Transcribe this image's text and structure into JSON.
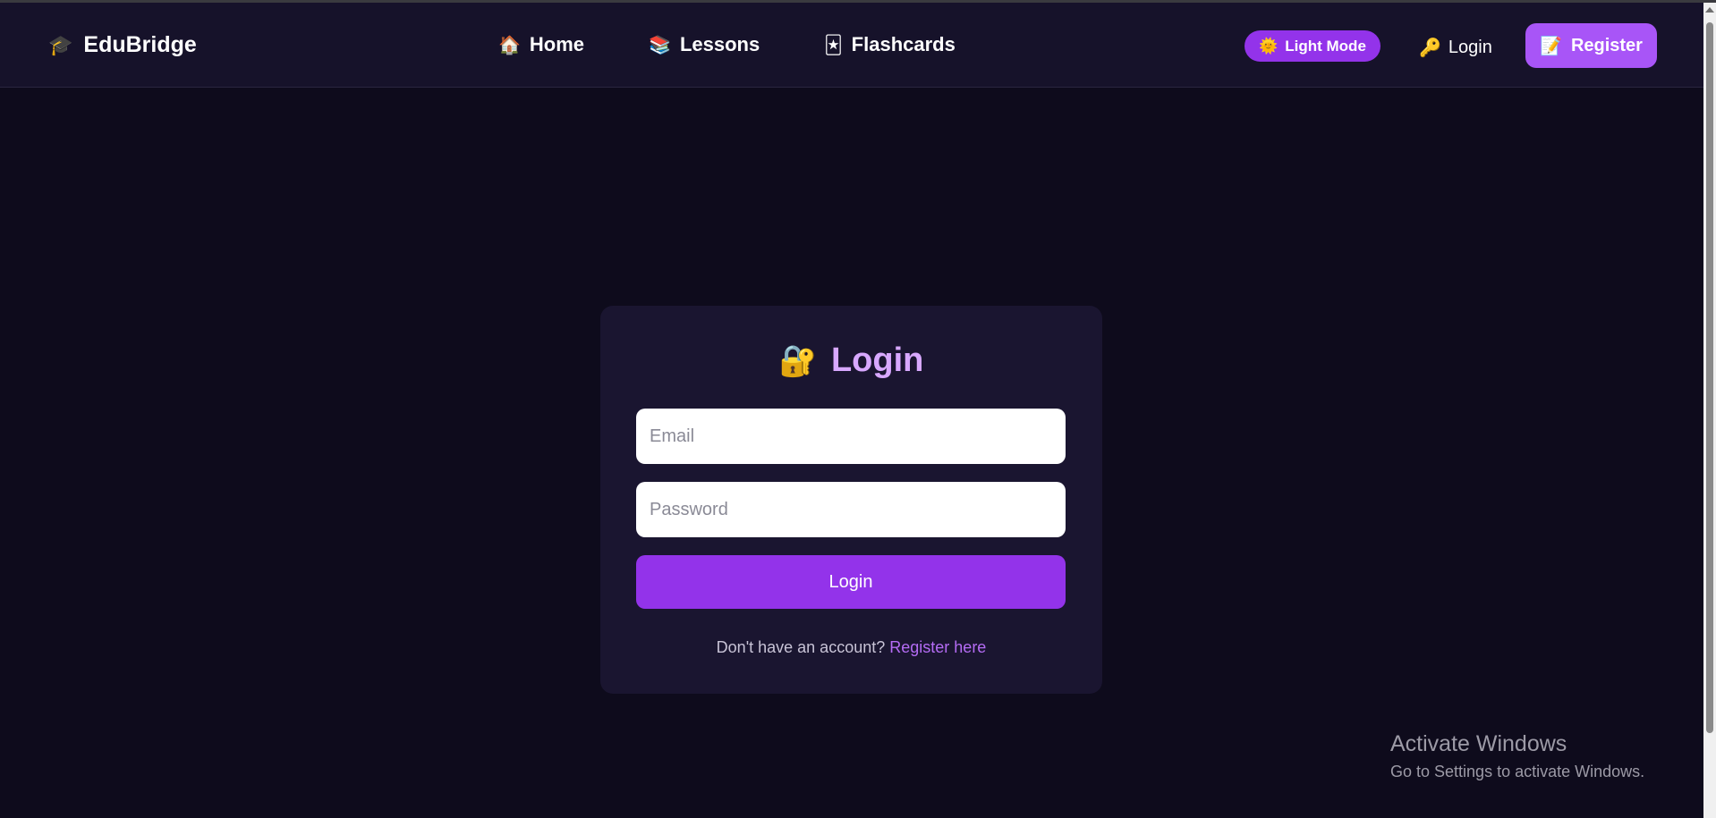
{
  "navbar": {
    "brand": {
      "icon": "graduation-cap-icon",
      "glyph": "🎓",
      "label": "EduBridge"
    },
    "links": [
      {
        "icon": "house-icon",
        "glyph": "🏠",
        "label": "Home"
      },
      {
        "icon": "books-icon",
        "glyph": "📚",
        "label": "Lessons"
      },
      {
        "icon": "joker-card-icon",
        "glyph": "🃏",
        "label": "Flashcards"
      }
    ],
    "theme_toggle": {
      "icon": "sun-face-icon",
      "glyph": "🌞",
      "label": "Light Mode"
    },
    "login": {
      "icon": "key-icon",
      "glyph": "🔑",
      "label": "Login"
    },
    "register": {
      "icon": "memo-icon",
      "glyph": "📝",
      "label": "Register"
    }
  },
  "login_card": {
    "icon": "lock-with-key-icon",
    "glyph": "🔐",
    "title": "Login",
    "email_placeholder": "Email",
    "password_placeholder": "Password",
    "submit_label": "Login",
    "signup_prompt": "Don't have an account?",
    "signup_link": "Register here"
  },
  "watermark": {
    "title": "Activate Windows",
    "subtitle": "Go to Settings to activate Windows."
  },
  "colors": {
    "background": "#0e0b1c",
    "navbar": "#16122a",
    "card": "#1a1530",
    "accent": "#9333ea",
    "accent_light": "#a855f7",
    "title": "#d8a8ff",
    "link": "#b56cf5"
  }
}
